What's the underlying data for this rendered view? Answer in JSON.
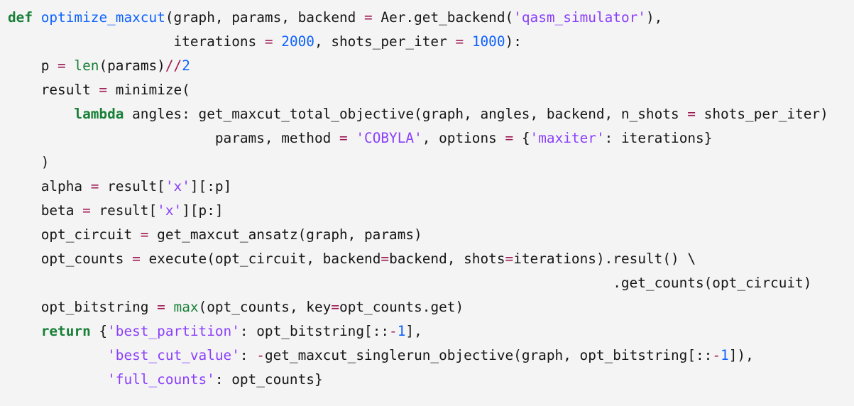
{
  "code": {
    "language": "python",
    "lines": [
      [
        {
          "t": "def",
          "k": "keyword"
        },
        {
          "t": " ",
          "k": "text"
        },
        {
          "t": "optimize_maxcut",
          "k": "funcname"
        },
        {
          "t": "(graph, params, backend ",
          "k": "text"
        },
        {
          "t": "=",
          "k": "operator"
        },
        {
          "t": " Aer.get_backend(",
          "k": "text"
        },
        {
          "t": "'qasm_simulator'",
          "k": "string"
        },
        {
          "t": "),",
          "k": "text"
        }
      ],
      [
        {
          "t": "                    iterations ",
          "k": "text"
        },
        {
          "t": "=",
          "k": "operator"
        },
        {
          "t": " ",
          "k": "text"
        },
        {
          "t": "2000",
          "k": "number"
        },
        {
          "t": ", shots_per_iter ",
          "k": "text"
        },
        {
          "t": "=",
          "k": "operator"
        },
        {
          "t": " ",
          "k": "text"
        },
        {
          "t": "1000",
          "k": "number"
        },
        {
          "t": "):",
          "k": "text"
        }
      ],
      [
        {
          "t": "    p ",
          "k": "text"
        },
        {
          "t": "=",
          "k": "operator"
        },
        {
          "t": " ",
          "k": "text"
        },
        {
          "t": "len",
          "k": "builtin"
        },
        {
          "t": "(params)",
          "k": "text"
        },
        {
          "t": "//",
          "k": "operator"
        },
        {
          "t": "2",
          "k": "number"
        }
      ],
      [
        {
          "t": "    result ",
          "k": "text"
        },
        {
          "t": "=",
          "k": "operator"
        },
        {
          "t": " minimize(",
          "k": "text"
        }
      ],
      [
        {
          "t": "        ",
          "k": "text"
        },
        {
          "t": "lambda",
          "k": "keyword"
        },
        {
          "t": " angles: get_maxcut_total_objective(graph, angles, backend, n_shots ",
          "k": "text"
        },
        {
          "t": "=",
          "k": "operator"
        },
        {
          "t": " shots_per_iter)",
          "k": "text"
        }
      ],
      [
        {
          "t": "                         params, method ",
          "k": "text"
        },
        {
          "t": "=",
          "k": "operator"
        },
        {
          "t": " ",
          "k": "text"
        },
        {
          "t": "'COBYLA'",
          "k": "string"
        },
        {
          "t": ", options ",
          "k": "text"
        },
        {
          "t": "=",
          "k": "operator"
        },
        {
          "t": " {",
          "k": "text"
        },
        {
          "t": "'maxiter'",
          "k": "string"
        },
        {
          "t": ": iterations}",
          "k": "text"
        }
      ],
      [
        {
          "t": "    )",
          "k": "text"
        }
      ],
      [
        {
          "t": "    alpha ",
          "k": "text"
        },
        {
          "t": "=",
          "k": "operator"
        },
        {
          "t": " result[",
          "k": "text"
        },
        {
          "t": "'x'",
          "k": "string"
        },
        {
          "t": "][:p]",
          "k": "text"
        }
      ],
      [
        {
          "t": "    beta ",
          "k": "text"
        },
        {
          "t": "=",
          "k": "operator"
        },
        {
          "t": " result[",
          "k": "text"
        },
        {
          "t": "'x'",
          "k": "string"
        },
        {
          "t": "][p:]",
          "k": "text"
        }
      ],
      [
        {
          "t": "    opt_circuit ",
          "k": "text"
        },
        {
          "t": "=",
          "k": "operator"
        },
        {
          "t": " get_maxcut_ansatz(graph, params)",
          "k": "text"
        }
      ],
      [
        {
          "t": "    opt_counts ",
          "k": "text"
        },
        {
          "t": "=",
          "k": "operator"
        },
        {
          "t": " execute(opt_circuit, backend",
          "k": "text"
        },
        {
          "t": "=",
          "k": "operator"
        },
        {
          "t": "backend, shots",
          "k": "text"
        },
        {
          "t": "=",
          "k": "operator"
        },
        {
          "t": "iterations).result() \\",
          "k": "text"
        }
      ],
      [
        {
          "t": "                                                                         .get_counts(opt_circuit)",
          "k": "text"
        }
      ],
      [
        {
          "t": "    opt_bitstring ",
          "k": "text"
        },
        {
          "t": "=",
          "k": "operator"
        },
        {
          "t": " ",
          "k": "text"
        },
        {
          "t": "max",
          "k": "builtin"
        },
        {
          "t": "(opt_counts, key",
          "k": "text"
        },
        {
          "t": "=",
          "k": "operator"
        },
        {
          "t": "opt_counts.get)",
          "k": "text"
        }
      ],
      [
        {
          "t": "    ",
          "k": "text"
        },
        {
          "t": "return",
          "k": "keyword"
        },
        {
          "t": " {",
          "k": "text"
        },
        {
          "t": "'best_partition'",
          "k": "string"
        },
        {
          "t": ": opt_bitstring[::",
          "k": "text"
        },
        {
          "t": "-",
          "k": "operator"
        },
        {
          "t": "1",
          "k": "number"
        },
        {
          "t": "],",
          "k": "text"
        }
      ],
      [
        {
          "t": "            ",
          "k": "text"
        },
        {
          "t": "'best_cut_value'",
          "k": "string"
        },
        {
          "t": ": ",
          "k": "text"
        },
        {
          "t": "-",
          "k": "operator"
        },
        {
          "t": "get_maxcut_singlerun_objective(graph, opt_bitstring[::",
          "k": "text"
        },
        {
          "t": "-",
          "k": "operator"
        },
        {
          "t": "1",
          "k": "number"
        },
        {
          "t": "]),",
          "k": "text"
        }
      ],
      [
        {
          "t": "            ",
          "k": "text"
        },
        {
          "t": "'full_counts'",
          "k": "string"
        },
        {
          "t": ": opt_counts}",
          "k": "text"
        }
      ]
    ]
  }
}
